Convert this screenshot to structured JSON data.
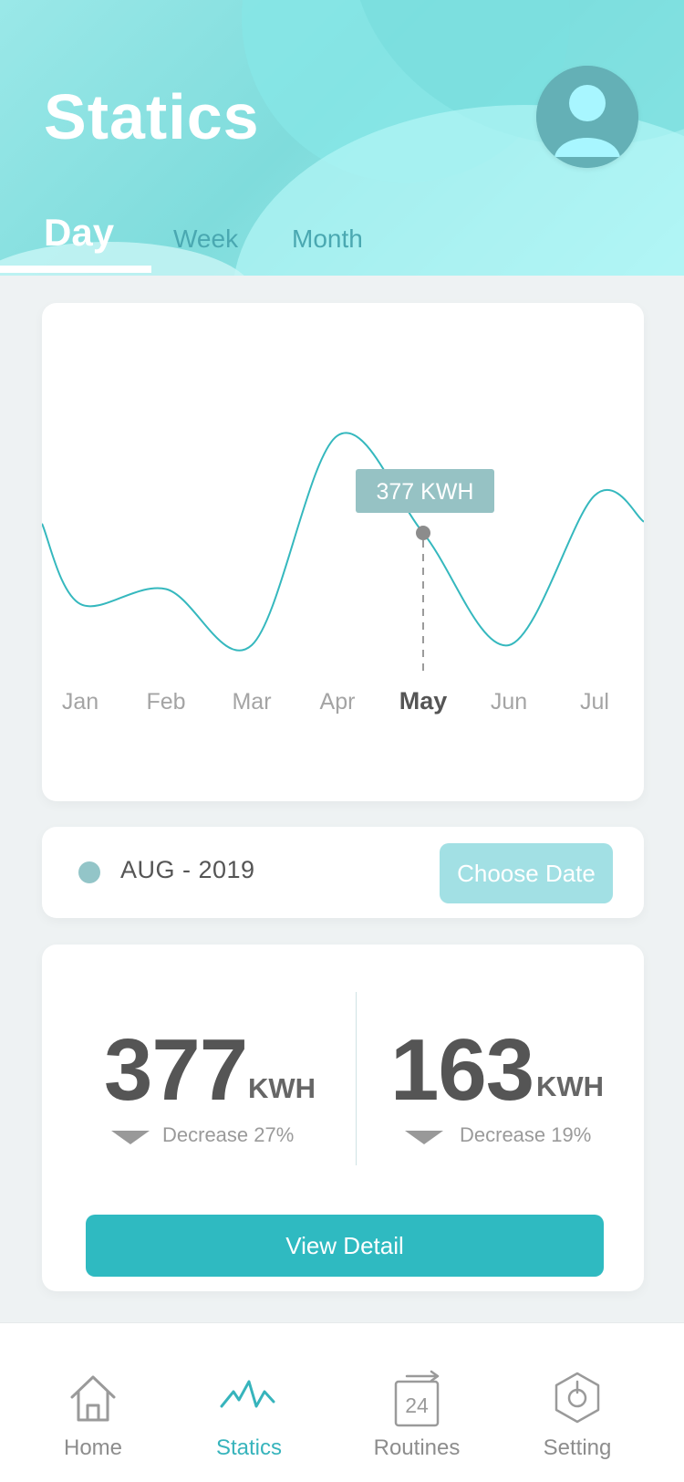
{
  "header": {
    "title": "Statics",
    "tabs": [
      "Day",
      "Week",
      "Month"
    ],
    "active_tab": "Day"
  },
  "chart_data": {
    "type": "line",
    "categories": [
      "Jan",
      "Feb",
      "Mar",
      "Apr",
      "May",
      "Jun",
      "Jul"
    ],
    "series": [
      {
        "values": [
          -1.9,
          -1.5,
          -3.0,
          2.6,
          0.0,
          -3.0,
          1.0
        ]
      }
    ],
    "selected_category": "May",
    "tooltip_label": "377 KWH",
    "x_axis_labels": [
      "Jan",
      "Feb",
      "Mar",
      "Apr",
      "May",
      "Jun",
      "Jul"
    ],
    "grid": false,
    "legend": "none"
  },
  "date_selector": {
    "label": "AUG - 2019",
    "choose_date_label": "Choose Date"
  },
  "stats": {
    "left": {
      "value": "377",
      "unit": "KWH",
      "change": "Decrease 27%"
    },
    "right": {
      "value": "163",
      "unit": "KWH",
      "change": "Decrease 19%"
    },
    "view_detail_label": "View Detail"
  },
  "bottom_nav": {
    "items": [
      {
        "label": "Home",
        "icon": "home-icon"
      },
      {
        "label": "Statics",
        "icon": "statics-icon"
      },
      {
        "label": "Routines",
        "icon": "calendar-24-icon",
        "icon_text": "24"
      },
      {
        "label": "Setting",
        "icon": "setting-icon"
      }
    ]
  },
  "colors": {
    "accent": "#2fbac1",
    "active_nav": "#37b4bc",
    "chart_line": "#35b8be",
    "tooltip": "#96c2c4",
    "muted_text": "#8d8d8d"
  }
}
